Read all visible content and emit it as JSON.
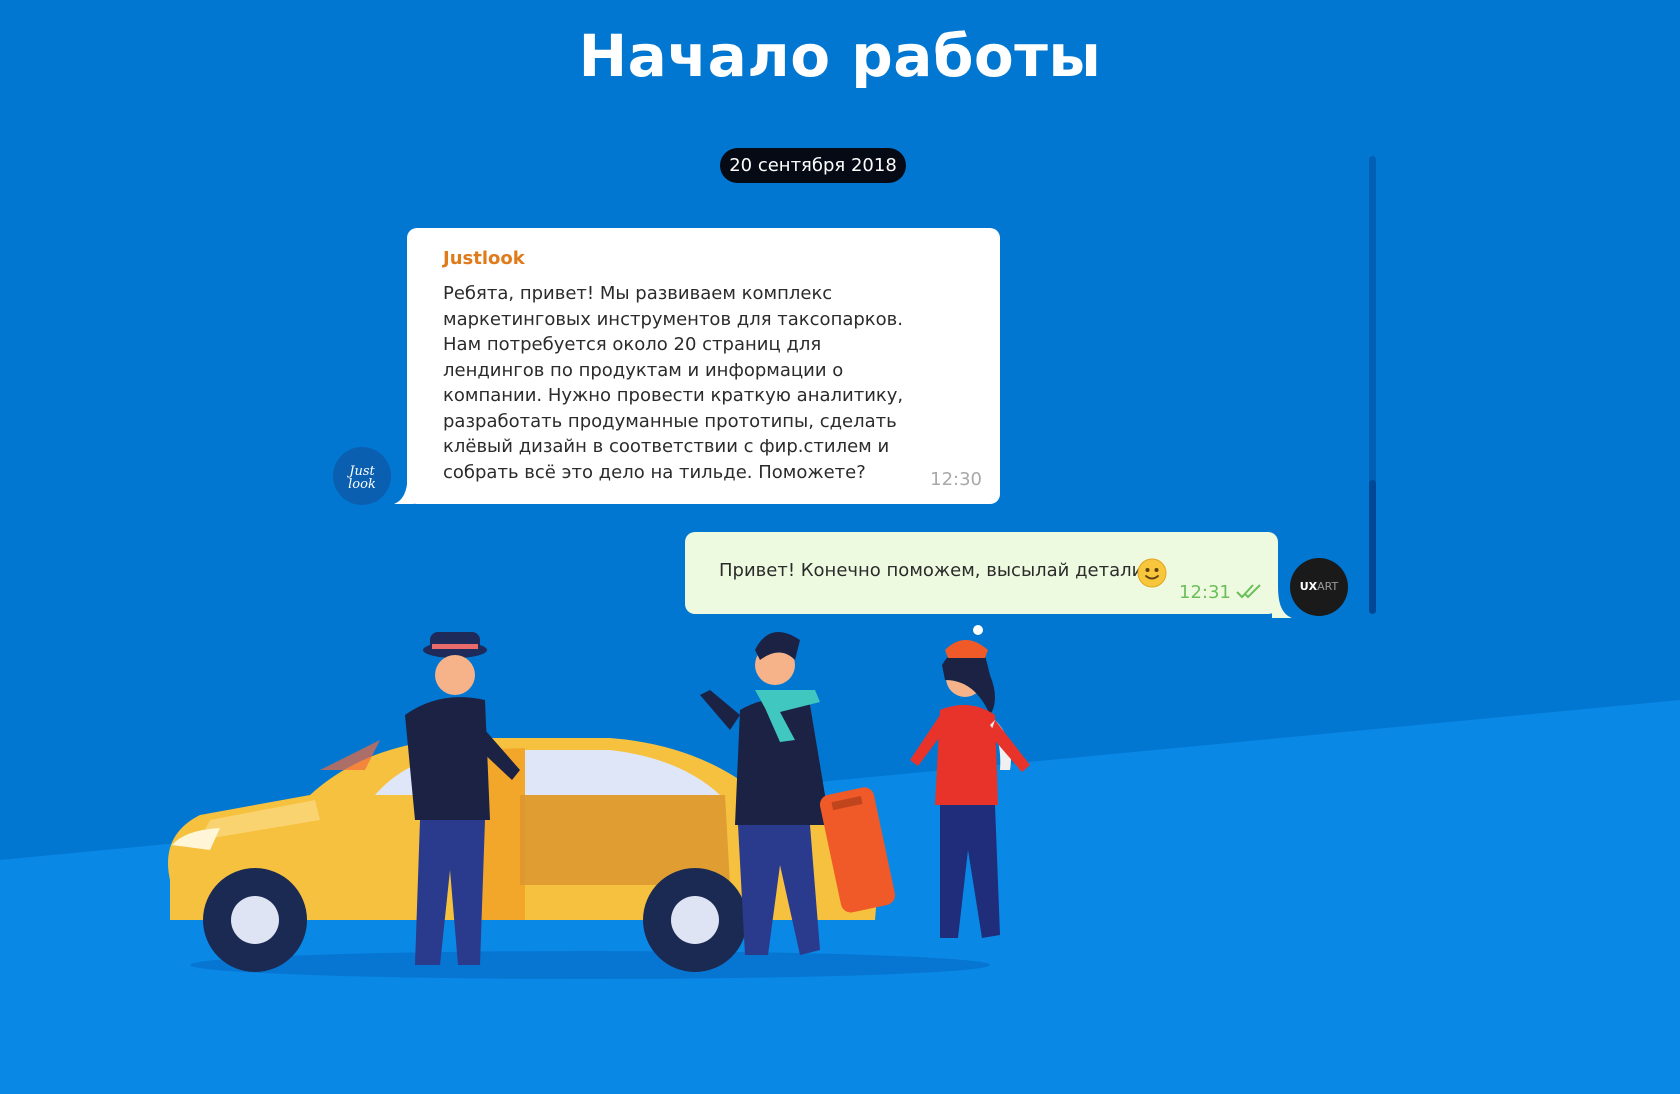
{
  "page": {
    "title": "Начало работы"
  },
  "chat": {
    "date": "20 сентября 2018",
    "messages": [
      {
        "sender": "Justlook",
        "text": "Ребята, привет! Мы развиваем комплекс маркетинговых инструментов для таксопарков. Нам потребуется около 20 страниц для лендингов по продуктам и информации о компании. Нужно провести краткую аналитику, разработать продуманные прототипы, сделать клёвый дизайн в соответствии с фир.стилем и собрать всё это дело на тильде. Поможете?",
        "time": "12:30",
        "avatar_icon": "justlook-logo-icon"
      },
      {
        "text": "Привет! Конечно поможем, высылай детали",
        "emoji": "slightly-smiling-face-icon",
        "time": "12:31",
        "status_icon": "double-check-icon",
        "avatar": {
          "brand": "UX",
          "brand_suffix": "ART"
        }
      }
    ]
  },
  "colors": {
    "background": "#0277d1",
    "background_lower": "#0a88e6",
    "incoming_bubble": "#ffffff",
    "outgoing_bubble": "#eefadf",
    "sender_name": "#e07b1b",
    "read_check": "#6bbf5a",
    "date_pill": "#050a14"
  },
  "illustration": {
    "icon": "taxi-scene-illustration"
  }
}
